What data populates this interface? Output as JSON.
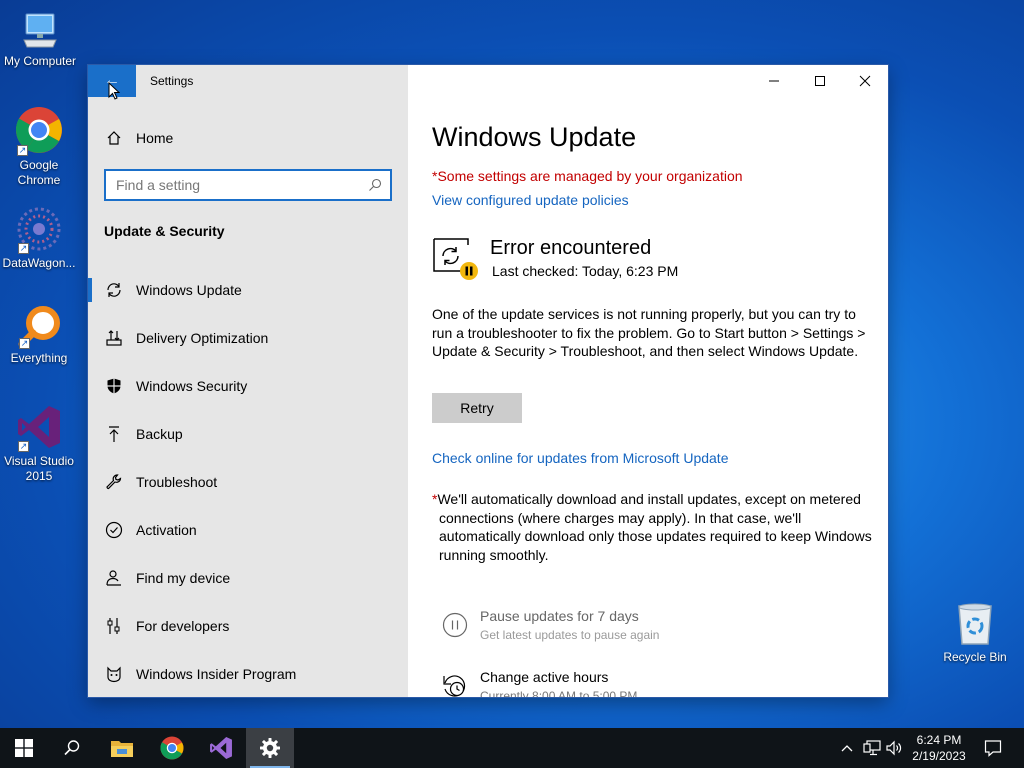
{
  "desktop": {
    "icons": [
      {
        "label": "My Computer"
      },
      {
        "label": "Google Chrome"
      },
      {
        "label": "DataWagon..."
      },
      {
        "label": "Everything"
      },
      {
        "label": "Visual Studio 2015"
      },
      {
        "label": "Recycle Bin"
      }
    ]
  },
  "window": {
    "title": "Settings",
    "back_icon": "back-arrow-icon",
    "controls": [
      "minimize-icon",
      "maximize-icon",
      "close-icon"
    ]
  },
  "sidebar": {
    "home_label": "Home",
    "search_placeholder": "Find a setting",
    "section_title": "Update & Security",
    "items": [
      {
        "label": "Windows Update",
        "icon": "sync-icon",
        "active": true
      },
      {
        "label": "Delivery Optimization",
        "icon": "delivery-icon"
      },
      {
        "label": "Windows Security",
        "icon": "shield-icon"
      },
      {
        "label": "Backup",
        "icon": "backup-arrow-icon"
      },
      {
        "label": "Troubleshoot",
        "icon": "wrench-icon"
      },
      {
        "label": "Activation",
        "icon": "check-circle-icon"
      },
      {
        "label": "Find my device",
        "icon": "person-pin-icon"
      },
      {
        "label": "For developers",
        "icon": "sliders-icon"
      },
      {
        "label": "Windows Insider Program",
        "icon": "insider-cat-icon"
      }
    ]
  },
  "content": {
    "title": "Windows Update",
    "managed_notice": "*Some settings are managed by your organization",
    "policies_link": "View configured update policies",
    "status_title": "Error encountered",
    "status_sub": "Last checked: Today, 6:23 PM",
    "description": "One of the update services is not running properly, but you can try to run a troubleshooter to fix the problem. Go to Start button > Settings > Update & Security > Troubleshoot, and then select Windows Update.",
    "retry_label": "Retry",
    "check_online_link": "Check online for updates from Microsoft Update",
    "note_star": "*",
    "note_text": "We'll automatically download and install updates, except on metered connections (where charges may apply). In that case, we'll automatically download only those updates required to keep Windows running smoothly.",
    "options": [
      {
        "title": "Pause updates for 7 days",
        "sub": "Get latest updates to pause again",
        "icon": "pause-circle-icon"
      },
      {
        "title": "Change active hours",
        "sub": "Currently 8:00 AM to 5:00 PM",
        "icon": "clock-icon"
      }
    ]
  },
  "taskbar": {
    "time": "6:24 PM",
    "date": "2/19/2023",
    "accent": "#1a6fc9"
  }
}
